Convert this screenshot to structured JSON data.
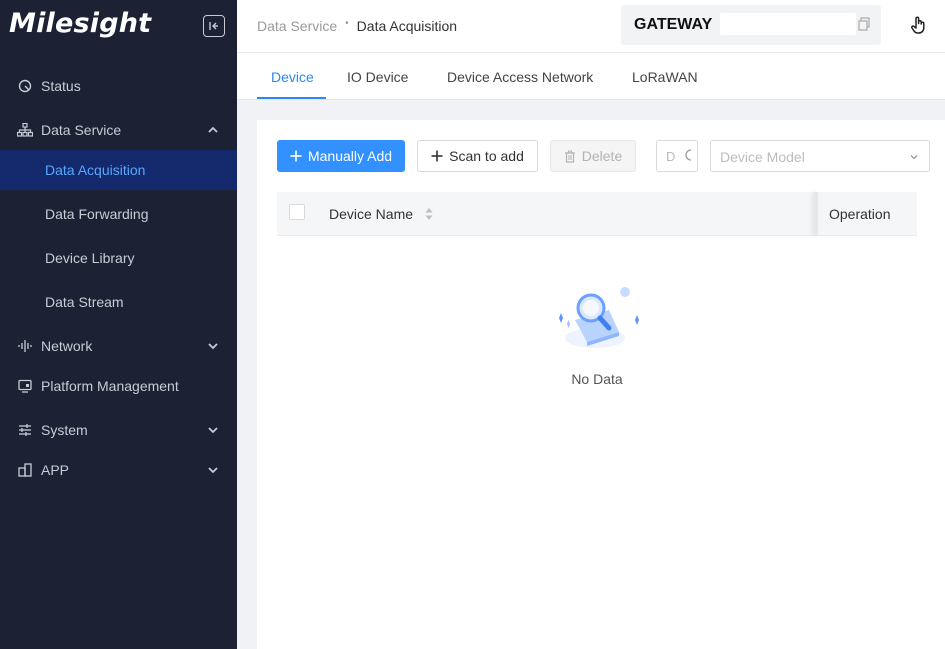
{
  "brand": {
    "logo_text": "Milesight"
  },
  "sidebar": {
    "items": [
      {
        "label": "Status",
        "icon": "status-icon"
      },
      {
        "label": "Data Service",
        "icon": "data-service-icon",
        "expanded": true,
        "children": [
          {
            "label": "Data Acquisition",
            "active": true
          },
          {
            "label": "Data Forwarding"
          },
          {
            "label": "Device Library"
          },
          {
            "label": "Data Stream"
          }
        ]
      },
      {
        "label": "Network",
        "icon": "network-icon"
      },
      {
        "label": "Platform Management",
        "icon": "platform-icon"
      },
      {
        "label": "System",
        "icon": "system-icon"
      },
      {
        "label": "APP",
        "icon": "app-icon"
      }
    ]
  },
  "header": {
    "breadcrumb": [
      "Data Service",
      "Data Acquisition"
    ],
    "gateway_label": "GATEWAY",
    "gateway_value": ""
  },
  "tabs": [
    {
      "label": "Device",
      "active": true
    },
    {
      "label": "IO Device"
    },
    {
      "label": "Device Access Network"
    },
    {
      "label": "LoRaWAN"
    }
  ],
  "toolbar": {
    "manual_add": "Manually Add",
    "scan_add": "Scan to add",
    "delete": "Delete",
    "small_field_text": "D",
    "model_placeholder": "Device Model"
  },
  "table": {
    "columns": [
      "Device Name",
      "Operation"
    ],
    "empty_text": "No Data"
  },
  "colors": {
    "sidebar_bg": "#1c2133",
    "active_item_bg": "#13296b",
    "accent": "#2f86f6",
    "primary_button": "#3391ff"
  }
}
